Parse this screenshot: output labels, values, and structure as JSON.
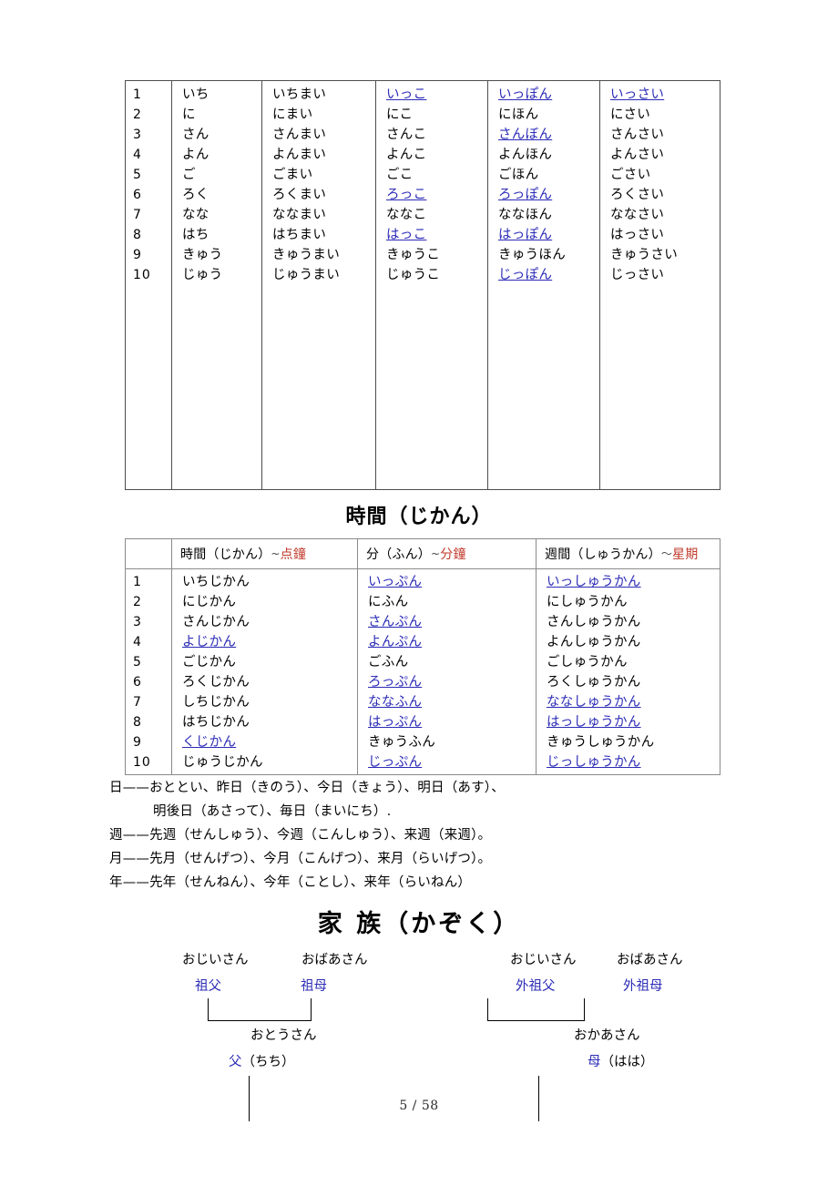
{
  "document": {
    "page_label": "5 / 58"
  },
  "counter_table": {
    "columns": [
      "",
      "",
      "",
      "",
      "",
      ""
    ],
    "rows": [
      {
        "num": "1",
        "c1": {
          "t": "いち",
          "link": false
        },
        "c2": {
          "t": "いちまい",
          "link": false
        },
        "c3": {
          "t": "いっこ",
          "link": true
        },
        "c4": {
          "t": "いっぽん",
          "link": true
        },
        "c5": {
          "t": "いっさい",
          "link": true
        }
      },
      {
        "num": "2",
        "c1": {
          "t": "に",
          "link": false
        },
        "c2": {
          "t": "にまい",
          "link": false
        },
        "c3": {
          "t": "にこ",
          "link": false
        },
        "c4": {
          "t": "にほん",
          "link": false
        },
        "c5": {
          "t": "にさい",
          "link": false
        }
      },
      {
        "num": "3",
        "c1": {
          "t": "さん",
          "link": false
        },
        "c2": {
          "t": "さんまい",
          "link": false
        },
        "c3": {
          "t": "さんこ",
          "link": false
        },
        "c4": {
          "t": "さんぼん",
          "link": true
        },
        "c5": {
          "t": "さんさい",
          "link": false
        }
      },
      {
        "num": "4",
        "c1": {
          "t": "よん",
          "link": false
        },
        "c2": {
          "t": "よんまい",
          "link": false
        },
        "c3": {
          "t": "よんこ",
          "link": false
        },
        "c4": {
          "t": "よんほん",
          "link": false
        },
        "c5": {
          "t": "よんさい",
          "link": false
        }
      },
      {
        "num": "5",
        "c1": {
          "t": "ご",
          "link": false
        },
        "c2": {
          "t": "ごまい",
          "link": false
        },
        "c3": {
          "t": "ごこ",
          "link": false
        },
        "c4": {
          "t": "ごほん",
          "link": false
        },
        "c5": {
          "t": "ごさい",
          "link": false
        }
      },
      {
        "num": "6",
        "c1": {
          "t": "ろく",
          "link": false
        },
        "c2": {
          "t": "ろくまい",
          "link": false
        },
        "c3": {
          "t": "ろっこ",
          "link": true
        },
        "c4": {
          "t": "ろっぽん",
          "link": true
        },
        "c5": {
          "t": "ろくさい",
          "link": false
        }
      },
      {
        "num": "7",
        "c1": {
          "t": "なな",
          "link": false
        },
        "c2": {
          "t": "ななまい",
          "link": false
        },
        "c3": {
          "t": "ななこ",
          "link": false
        },
        "c4": {
          "t": "ななほん",
          "link": false
        },
        "c5": {
          "t": "ななさい",
          "link": false
        }
      },
      {
        "num": "8",
        "c1": {
          "t": "はち",
          "link": false
        },
        "c2": {
          "t": "はちまい",
          "link": false
        },
        "c3": {
          "t": "はっこ",
          "link": true
        },
        "c4": {
          "t": "はっぽん",
          "link": true
        },
        "c5": {
          "t": "はっさい",
          "link": false
        }
      },
      {
        "num": "9",
        "c1": {
          "t": "きゅう",
          "link": false
        },
        "c2": {
          "t": "きゅうまい",
          "link": false
        },
        "c3": {
          "t": "きゅうこ",
          "link": false
        },
        "c4": {
          "t": "きゅうほん",
          "link": false
        },
        "c5": {
          "t": "きゅうさい",
          "link": false
        }
      },
      {
        "num": "10",
        "c1": {
          "t": "じゅう",
          "link": false
        },
        "c2": {
          "t": "じゅうまい",
          "link": false
        },
        "c3": {
          "t": "じゅうこ",
          "link": false
        },
        "c4": {
          "t": "じっぽん",
          "link": true
        },
        "c5": {
          "t": "じっさい",
          "link": false
        }
      }
    ]
  },
  "jikan_section": {
    "title": "時間（じかん）",
    "headers": [
      {
        "jp": "",
        "cn": ""
      },
      {
        "jp": "時間（じかん）",
        "sep": "~",
        "cn": "点鐘"
      },
      {
        "jp": "分（ふん）",
        "sep": "~",
        "cn": "分鐘"
      },
      {
        "jp": "週間（しゅうかん）",
        "sep": "～",
        "cn": "星期"
      }
    ],
    "rows": [
      {
        "num": "1",
        "hour": {
          "t": "いちじかん",
          "link": false
        },
        "minute": {
          "t": "いっぷん",
          "link": true
        },
        "week": {
          "t": "いっしゅうかん",
          "link": true
        }
      },
      {
        "num": "2",
        "hour": {
          "t": "にじかん",
          "link": false
        },
        "minute": {
          "t": "にふん",
          "link": false
        },
        "week": {
          "t": "にしゅうかん",
          "link": false
        }
      },
      {
        "num": "3",
        "hour": {
          "t": "さんじかん",
          "link": false
        },
        "minute": {
          "t": "さんぷん",
          "link": true
        },
        "week": {
          "t": "さんしゅうかん",
          "link": false
        }
      },
      {
        "num": "4",
        "hour": {
          "t": "よじかん",
          "link": true
        },
        "minute": {
          "t": "よんぷん",
          "link": true
        },
        "week": {
          "t": "よんしゅうかん",
          "link": false
        }
      },
      {
        "num": "5",
        "hour": {
          "t": "ごじかん",
          "link": false
        },
        "minute": {
          "t": "ごふん",
          "link": false
        },
        "week": {
          "t": "ごしゅうかん",
          "link": false
        }
      },
      {
        "num": "6",
        "hour": {
          "t": "ろくじかん",
          "link": false
        },
        "minute": {
          "t": "ろっぷん",
          "link": true
        },
        "week": {
          "t": "ろくしゅうかん",
          "link": false
        }
      },
      {
        "num": "7",
        "hour": {
          "t": "しちじかん",
          "link": false
        },
        "minute": {
          "t": "ななふん",
          "link": true
        },
        "week": {
          "t": "ななしゅうかん",
          "link": true
        }
      },
      {
        "num": "8",
        "hour": {
          "t": "はちじかん",
          "link": false
        },
        "minute": {
          "t": "はっぷん",
          "link": true
        },
        "week": {
          "t": "はっしゅうかん",
          "link": true
        }
      },
      {
        "num": "9",
        "hour": {
          "t": "くじかん",
          "link": true
        },
        "minute": {
          "t": "きゅうふん",
          "link": false
        },
        "week": {
          "t": "きゅうしゅうかん",
          "link": false
        }
      },
      {
        "num": "10",
        "hour": {
          "t": "じゅうじかん",
          "link": false
        },
        "minute": {
          "t": "じっぷん",
          "link": true
        },
        "week": {
          "t": "じっしゅうかん",
          "link": true
        }
      }
    ]
  },
  "notes": {
    "lines": [
      {
        "text": "日——おととい、昨日（きのう）、今日（きょう）、明日（あす）、",
        "indent": false
      },
      {
        "text": "明後日（あさって）、毎日（まいにち）.",
        "indent": true
      },
      {
        "text": "週——先週（せんしゅう）、今週（こんしゅう）、来週（来週）。",
        "indent": false
      },
      {
        "text": "月——先月（せんげつ）、今月（こんげつ）、来月（らいげつ）。",
        "indent": false
      },
      {
        "text": "年——先年（せんねん）、今年（ことし）、来年（らいねん）",
        "indent": false
      }
    ]
  },
  "kazoku_section": {
    "title": "家 族（かぞく）",
    "nodes": {
      "paternal_grandfather_kana": "おじいさん",
      "paternal_grandmother_kana": "おばあさん",
      "paternal_grandfather_kanji": "祖父",
      "paternal_grandmother_kanji": "祖母",
      "maternal_grandfather_kana": "おじいさん",
      "maternal_grandmother_kana": "おばあさん",
      "maternal_grandfather_kanji": "外祖父",
      "maternal_grandmother_kanji": "外祖母",
      "father_kana": "おとうさん",
      "father_kanji": "父",
      "father_reading": "（ちち）",
      "mother_kana": "おかあさん",
      "mother_kanji": "母",
      "mother_reading": "（はは）"
    }
  },
  "colors": {
    "link_blue": "#2b2bb7",
    "chinese_red": "#c0392b",
    "table_border": "#4d4d4d",
    "text_black": "#000000"
  }
}
